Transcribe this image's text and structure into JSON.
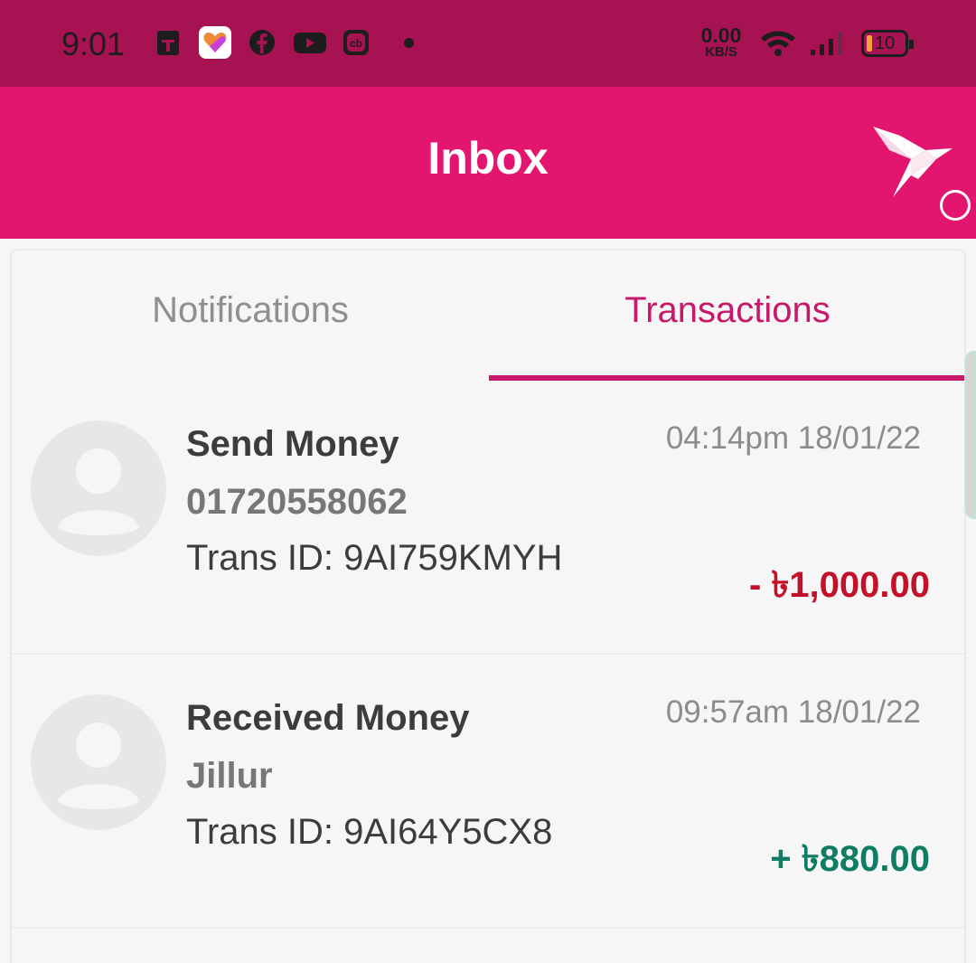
{
  "status_bar": {
    "time": "9:01",
    "speed_value": "0.00",
    "speed_unit": "KB/S",
    "battery_level": "10",
    "icons": [
      "sim-card-icon",
      "likee-app-icon",
      "facebook-icon",
      "youtube-icon",
      "cb-app-icon",
      "notification-dot-icon",
      "wifi-icon",
      "signal-icon",
      "battery-icon"
    ]
  },
  "header": {
    "title": "Inbox",
    "icons": [
      "bkash-bird-logo-icon",
      "circle-icon"
    ],
    "color": "#e2156f"
  },
  "tabs": [
    {
      "label": "Notifications",
      "active": false
    },
    {
      "label": "Transactions",
      "active": true
    }
  ],
  "transactions": [
    {
      "type": "Send Money",
      "party": "01720558062",
      "trans_id": "Trans ID: 9AI759KMYH",
      "time": "04:14pm 18/01/22",
      "amount": "- ৳1,000.00",
      "direction": "debit"
    },
    {
      "type": "Received Money",
      "party": "Jillur",
      "trans_id": "Trans ID: 9AI64Y5CX8",
      "time": "09:57am 18/01/22",
      "amount": "+ ৳880.00",
      "direction": "credit"
    }
  ],
  "colors": {
    "status_bar": "#a61252",
    "accent": "#c8186a",
    "debit": "#c4112a",
    "credit": "#0e7d63"
  }
}
